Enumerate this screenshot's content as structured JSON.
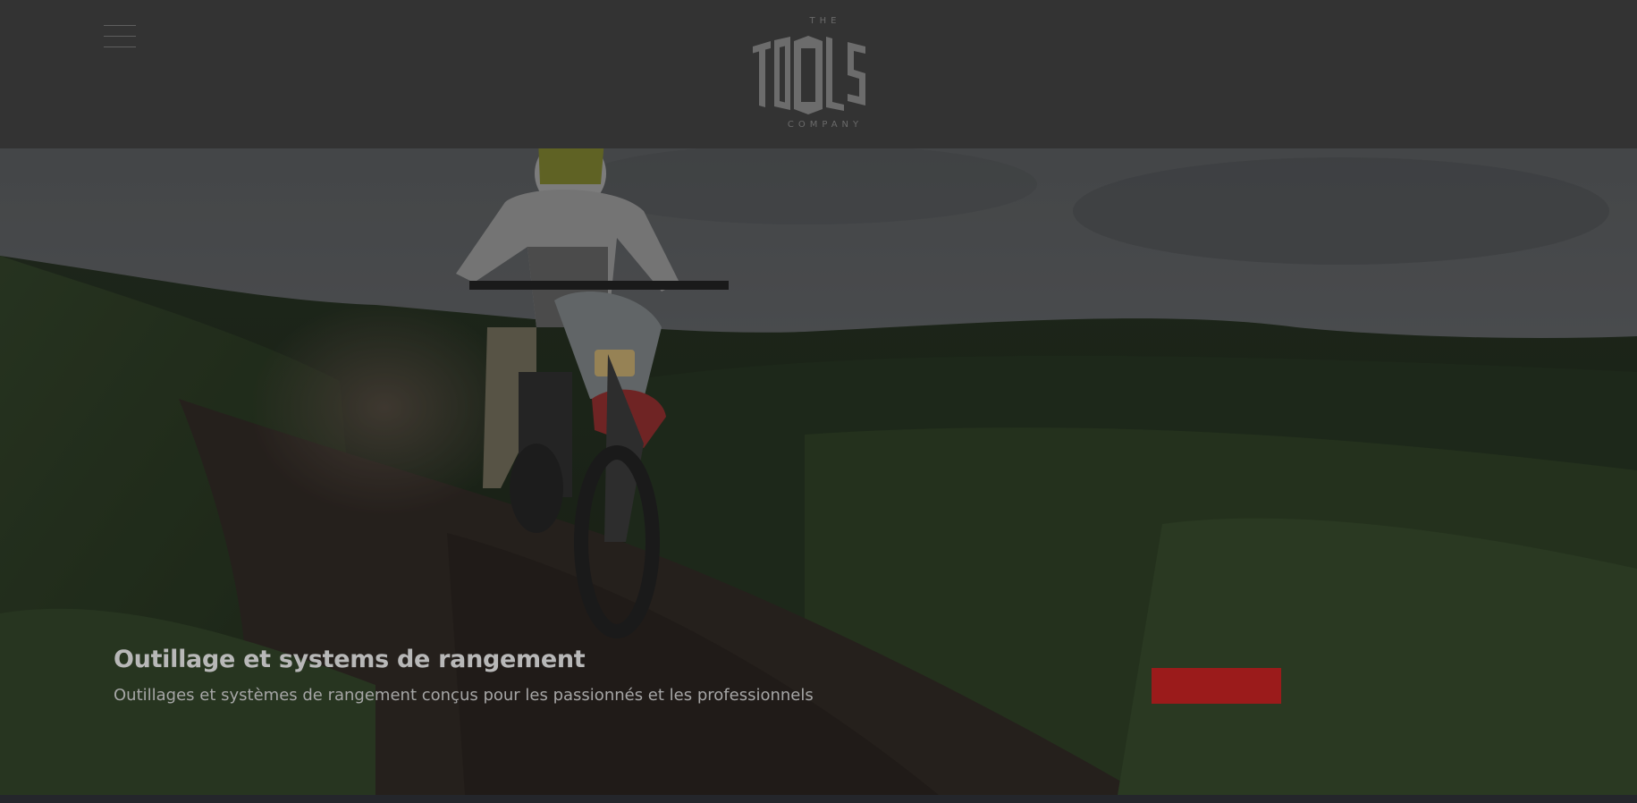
{
  "header": {
    "menu_icon": "hamburger-menu-icon",
    "logo": {
      "top_text": "THE",
      "main_text": "TOOLS",
      "bottom_text": "COMPANY"
    }
  },
  "hero": {
    "title": "Outillage et systems de rangement",
    "subtitle": "Outillages et systèmes de rangement conçus pour les passionnés et les professionnels",
    "cta_label": "",
    "colors": {
      "cta_background": "#9b1b1b",
      "header_background": "#333333"
    }
  }
}
